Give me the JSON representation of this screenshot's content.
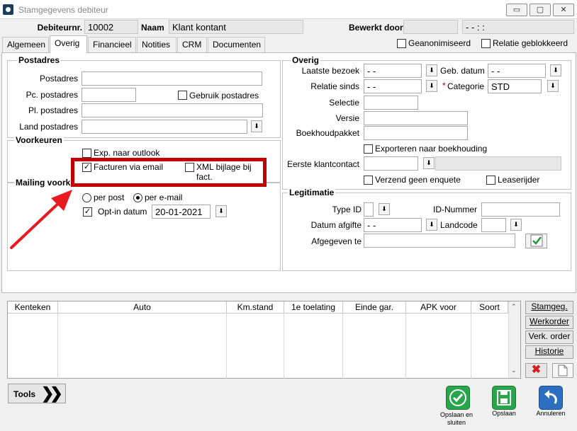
{
  "window": {
    "title": "Stamgegevens debiteur",
    "min": "▭",
    "max": "▢",
    "close": "✕"
  },
  "header": {
    "debiteurnr_label": "Debiteurnr.",
    "debiteurnr": "10002",
    "naam_label": "Naam",
    "naam": "Klant kontant",
    "bewerkt_door_label": "Bewerkt door",
    "bewerkt_door": "",
    "bewerkt_tijd": " -   -          :  :"
  },
  "tabs": [
    "Algemeen",
    "Overig",
    "Financieel",
    "Notities",
    "CRM",
    "Documenten"
  ],
  "flags": {
    "geanonimiseerd": "Geanonimiseerd",
    "relatie_geblokkeerd": "Relatie geblokkeerd"
  },
  "postadres": {
    "title": "Postadres",
    "postadres_label": "Postadres",
    "postadres": "",
    "pc_label": "Pc. postadres",
    "pc": "",
    "gebruik_label": "Gebruik postadres",
    "pl_label": "Pl. postadres",
    "pl": "",
    "land_label": "Land postadres",
    "land": ""
  },
  "voorkeuren": {
    "title": "Voorkeuren",
    "exp_outlook": "Exp. naar outlook",
    "facturen_email": "Facturen via email",
    "xml_bijlage": "XML bijlage bij",
    "xml_bijlage2": "fact."
  },
  "mailing": {
    "title": "Mailing voorkeur",
    "per_post": "per post",
    "per_email": "per e-mail",
    "optin_label": "Opt-in datum",
    "optin": "20-01-2021"
  },
  "overig": {
    "title": "Overig",
    "laatste_bezoek_label": "Laatste bezoek",
    "laatste_bezoek": " -   -",
    "geb_datum_label": "Geb. datum",
    "geb_datum": " -   -",
    "relatie_sinds_label": "Relatie sinds",
    "relatie_sinds": " -   -",
    "categorie_star": "*",
    "categorie_label": "Categorie",
    "categorie": "STD",
    "selectie_label": "Selectie",
    "selectie": "",
    "versie_label": "Versie",
    "versie": "",
    "boekhoud_label": "Boekhoudpakket",
    "boekhoud": "",
    "exporteren_label": "Exporteren naar boekhouding",
    "eerste_label": "Eerste klantcontact",
    "eerste": "",
    "verzend_label": "Verzend geen enquete",
    "leaserijder_label": "Leaserijder"
  },
  "legitimatie": {
    "title": "Legitimatie",
    "type_label": "Type ID",
    "type": "",
    "idnr_label": "ID-Nummer",
    "idnr": "",
    "afgifte_label": "Datum afgifte",
    "afgifte": " -   -",
    "landcode_label": "Landcode",
    "landcode": "",
    "afgegeven_label": "Afgegeven te",
    "afgegeven": ""
  },
  "grid": {
    "headers": [
      "Kenteken",
      "Auto",
      "Km.stand",
      "1e toelating",
      "Einde gar.",
      "APK voor",
      "Soort"
    ]
  },
  "side_buttons": [
    "Stamgeg.",
    "Werkorder",
    "Verk. order",
    "Historie"
  ],
  "footer": {
    "tools": "Tools",
    "save_close": "Opslaan en sluiten",
    "save": "Opslaan",
    "cancel": "Annuleren"
  },
  "colors": {
    "highlight": "#c00000",
    "arrow": "#e8191f",
    "save_green": "#2aa64a",
    "cancel_blue": "#2c6fc1"
  }
}
